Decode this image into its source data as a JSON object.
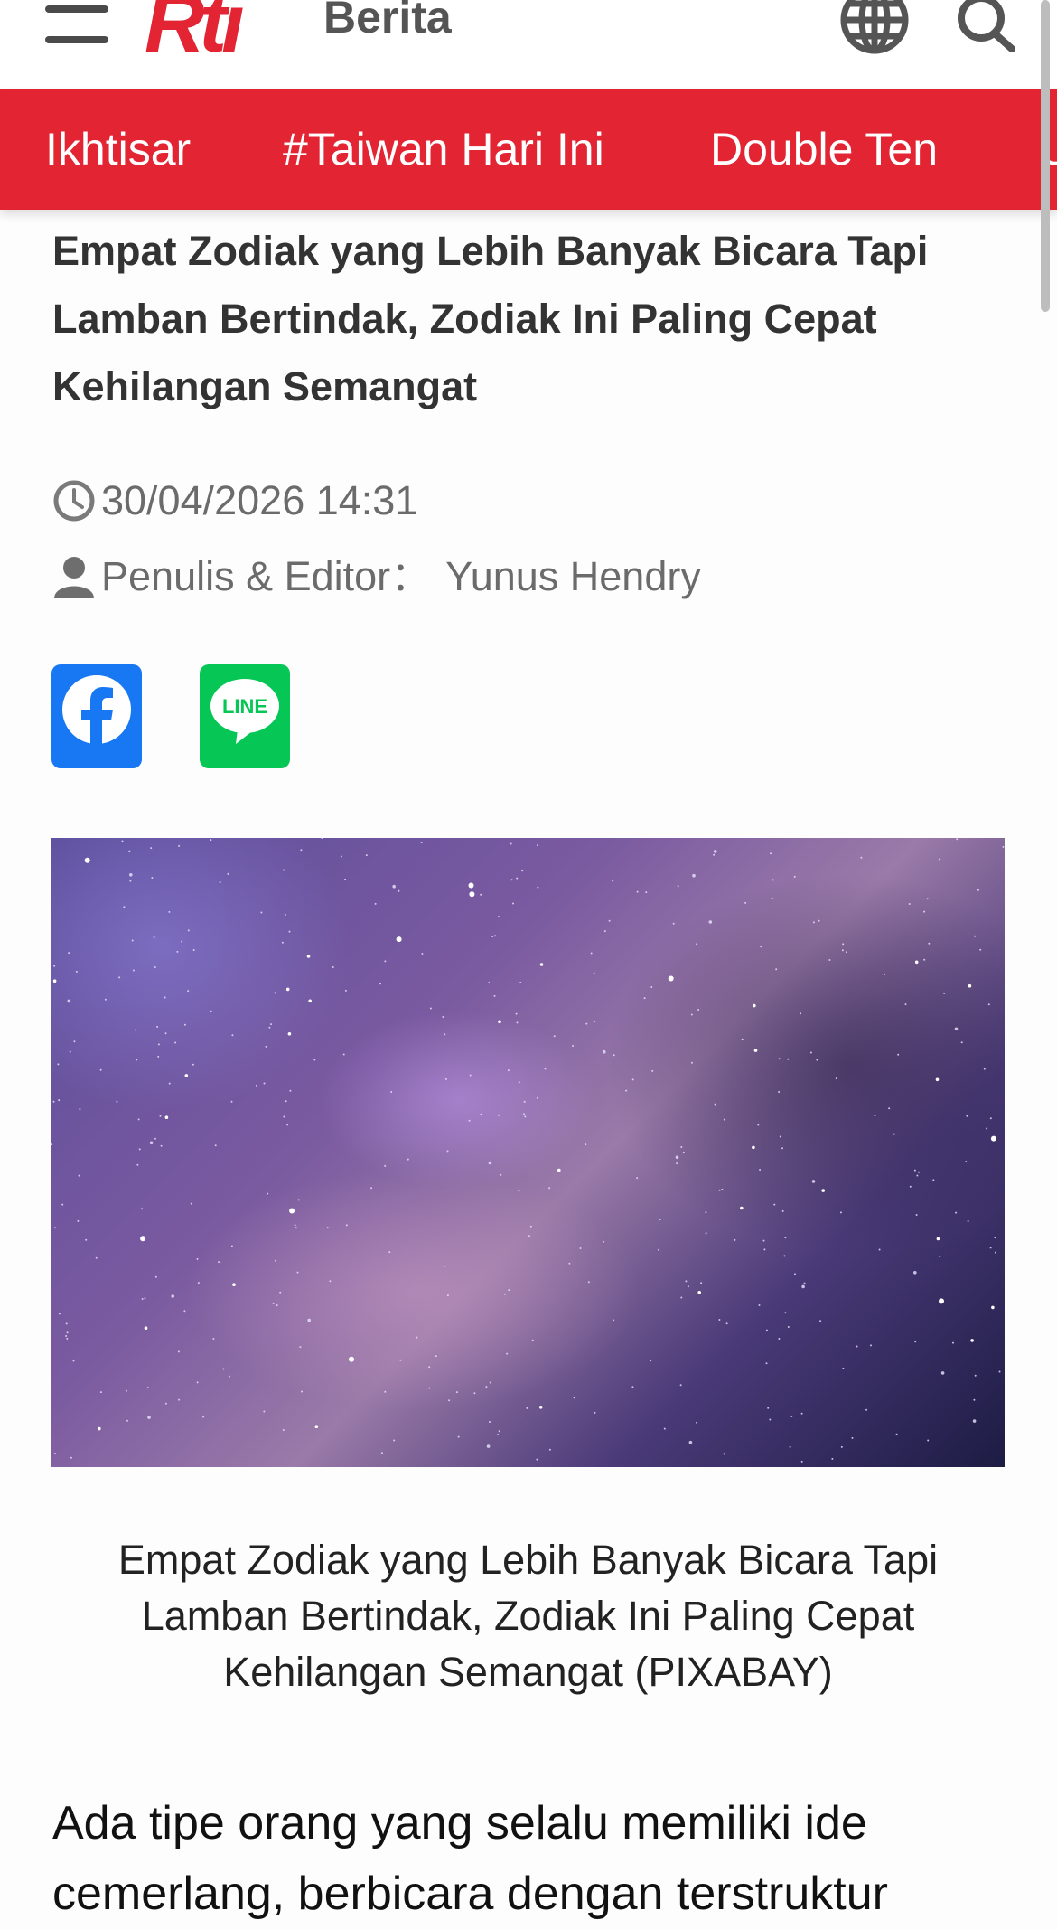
{
  "header": {
    "logo_text": "Rti",
    "section_title": "Berita"
  },
  "nav": {
    "items": [
      "Ikhtisar",
      "#Taiwan Hari Ini",
      "Double Ten",
      "U"
    ]
  },
  "article": {
    "headline": "Empat Zodiak yang Lebih Banyak Bicara Tapi Lamban Bertindak, Zodiak Ini Paling Cepat Kehilangan Semangat",
    "datetime": "30/04/2026 14:31",
    "author_label": "Penulis & Editor：",
    "author_name": "Yunus Hendry",
    "share": {
      "facebook_icon": "facebook-icon",
      "line_icon": "line-icon",
      "line_text": "LINE"
    },
    "image_caption": "Empat Zodiak yang Lebih Banyak Bicara Tapi Lamban Bertindak, Zodiak Ini Paling Cepat Kehilangan Semangat (PIXABAY)",
    "body_start": "Ada tipe orang yang selalu memiliki ide cemerlang, berbicara dengan terstruktur"
  },
  "colors": {
    "brand_red": "#e32533",
    "facebook_blue": "#1877f2",
    "line_green": "#06c755"
  }
}
